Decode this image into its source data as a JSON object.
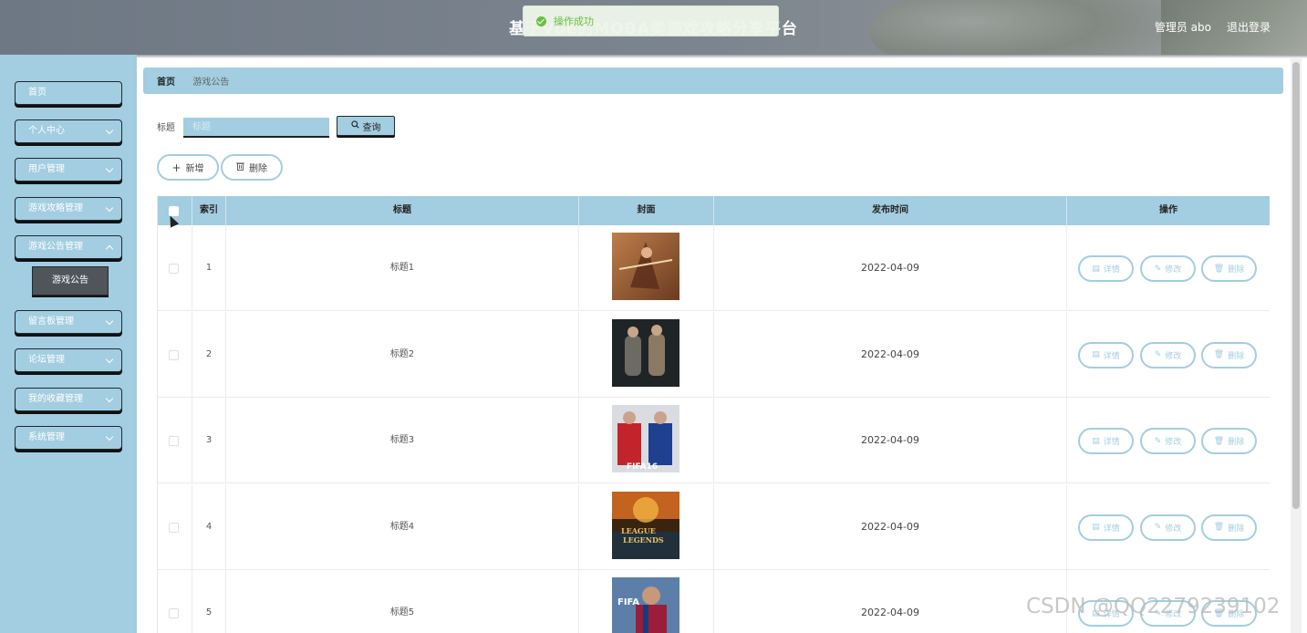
{
  "header": {
    "title": "基于Vue的MOBA类游戏攻略分享平台",
    "user_label": "管理员 abo",
    "logout_label": "退出登录"
  },
  "toast": {
    "message": "操作成功",
    "color": "#67c23a"
  },
  "sidebar": {
    "items": [
      {
        "label": "首页",
        "expandable": false
      },
      {
        "label": "个人中心",
        "expandable": true
      },
      {
        "label": "用户管理",
        "expandable": true
      },
      {
        "label": "游戏攻略管理",
        "expandable": true
      },
      {
        "label": "游戏公告管理",
        "expandable": true
      },
      {
        "label": "留言板管理",
        "expandable": true
      },
      {
        "label": "论坛管理",
        "expandable": true
      },
      {
        "label": "我的收藏管理",
        "expandable": true
      },
      {
        "label": "系统管理",
        "expandable": true
      }
    ],
    "active_sub": "游戏公告"
  },
  "breadcrumb": {
    "home": "首页",
    "current": "游戏公告"
  },
  "search": {
    "label": "标题",
    "placeholder": "标题",
    "value": "",
    "button": "查询"
  },
  "actions": {
    "add": "新增",
    "delete": "删除"
  },
  "table": {
    "columns": [
      "索引",
      "标题",
      "封面",
      "发布时间",
      "操作"
    ],
    "rows": [
      {
        "index": "1",
        "title": "标题1",
        "date": "2022-04-09"
      },
      {
        "index": "2",
        "title": "标题2",
        "date": "2022-04-09"
      },
      {
        "index": "3",
        "title": "标题3",
        "date": "2022-04-09"
      },
      {
        "index": "4",
        "title": "标题4",
        "date": "2022-04-09"
      },
      {
        "index": "5",
        "title": "标题5",
        "date": "2022-04-09"
      }
    ],
    "row_actions": {
      "detail": "详情",
      "edit": "修改",
      "delete": "删除"
    }
  },
  "watermark": "CSDN @QQ2279239102",
  "colors": {
    "accent": "#a3cde0",
    "header": "#7c858f"
  }
}
